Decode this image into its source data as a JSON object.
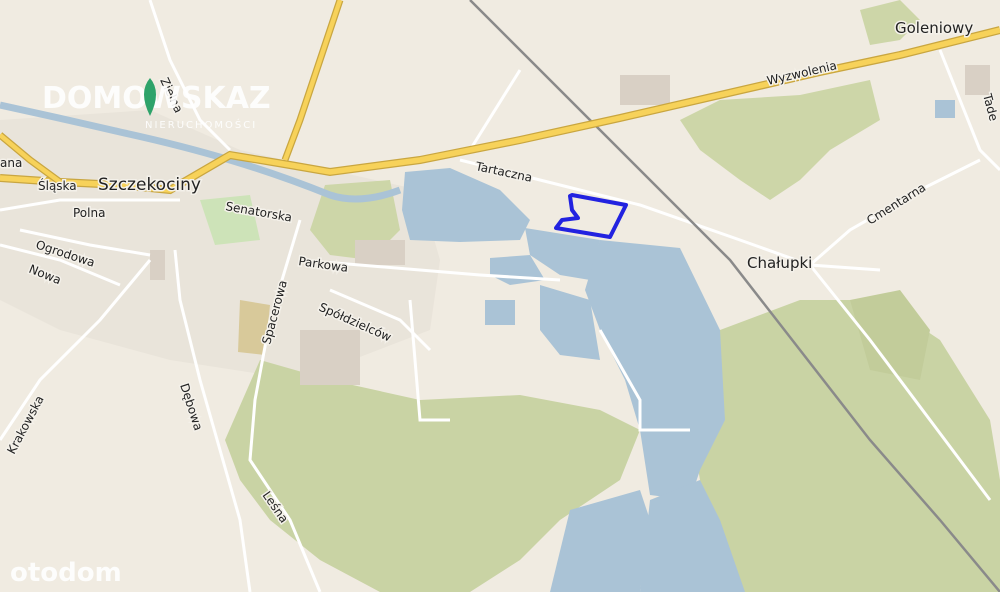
{
  "map": {
    "places": {
      "szczekociny": "Szczekociny",
      "goleniowy": "Goleniowy",
      "chalupki": "Chałupki"
    },
    "streets": {
      "wyzwolenia": "Wyzwolenia",
      "tartaczna": "Tartaczna",
      "slaska": "Śląska",
      "polna": "Polna",
      "senatorska": "Senatorska",
      "ogrodowa": "Ogrodowa",
      "nowa": "Nowa",
      "parkowa": "Parkowa",
      "spoldzielcow": "Spółdzielców",
      "spacerowa": "Spacerowa",
      "krakowska": "Krakowska",
      "debowa": "Dębowa",
      "lesna": "Leśna",
      "cmentarna": "Cmentarna",
      "zielna": "Zielna",
      "tadeusza": "Tade",
      "ana": "ana"
    },
    "colors": {
      "background": "#f0ebe1",
      "forest": "#c9d3a4",
      "water": "#aac3d6",
      "major_road": "#f7d25a",
      "parcel_outline": "#2222e0",
      "railway": "#8a8a8a"
    }
  },
  "watermarks": {
    "brand_top": "DOMOWSKAZ",
    "brand_sub": "NIERUCHOMOŚCI",
    "brand_bottom": "otodom"
  }
}
